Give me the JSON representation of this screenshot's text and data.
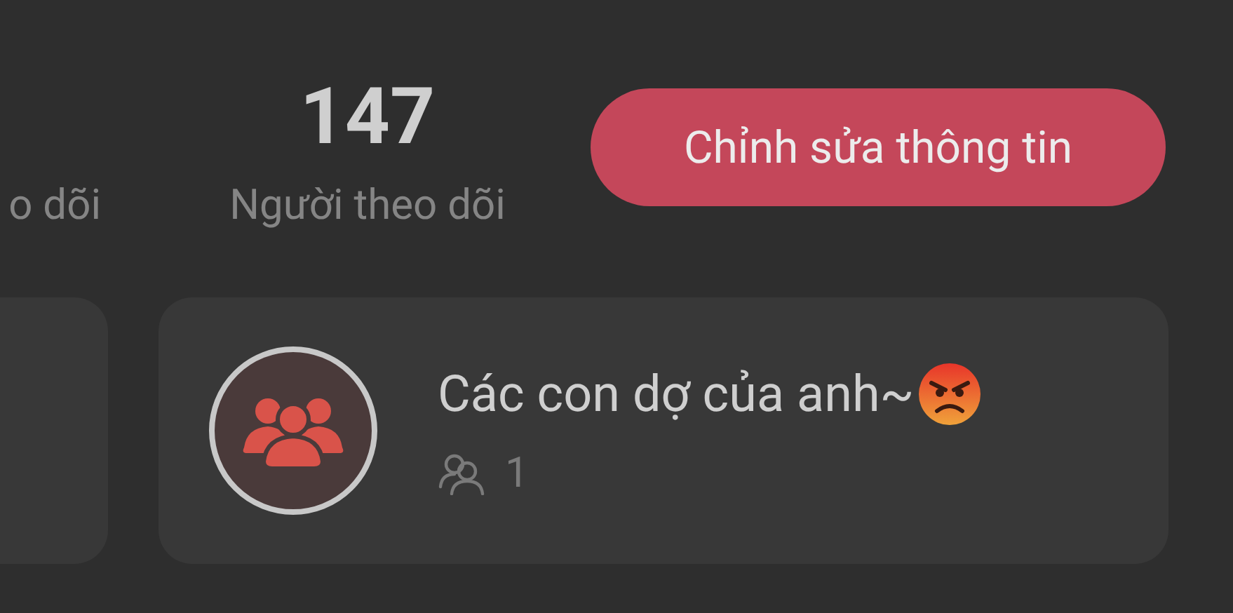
{
  "stats": [
    {
      "label": "o dõi"
    },
    {
      "value": "147",
      "label": "Người theo dõi"
    }
  ],
  "edit_button": {
    "label": "Chỉnh sửa thông tin"
  },
  "group_card": {
    "name": "Các con dợ của anh~",
    "member_count": "1"
  }
}
